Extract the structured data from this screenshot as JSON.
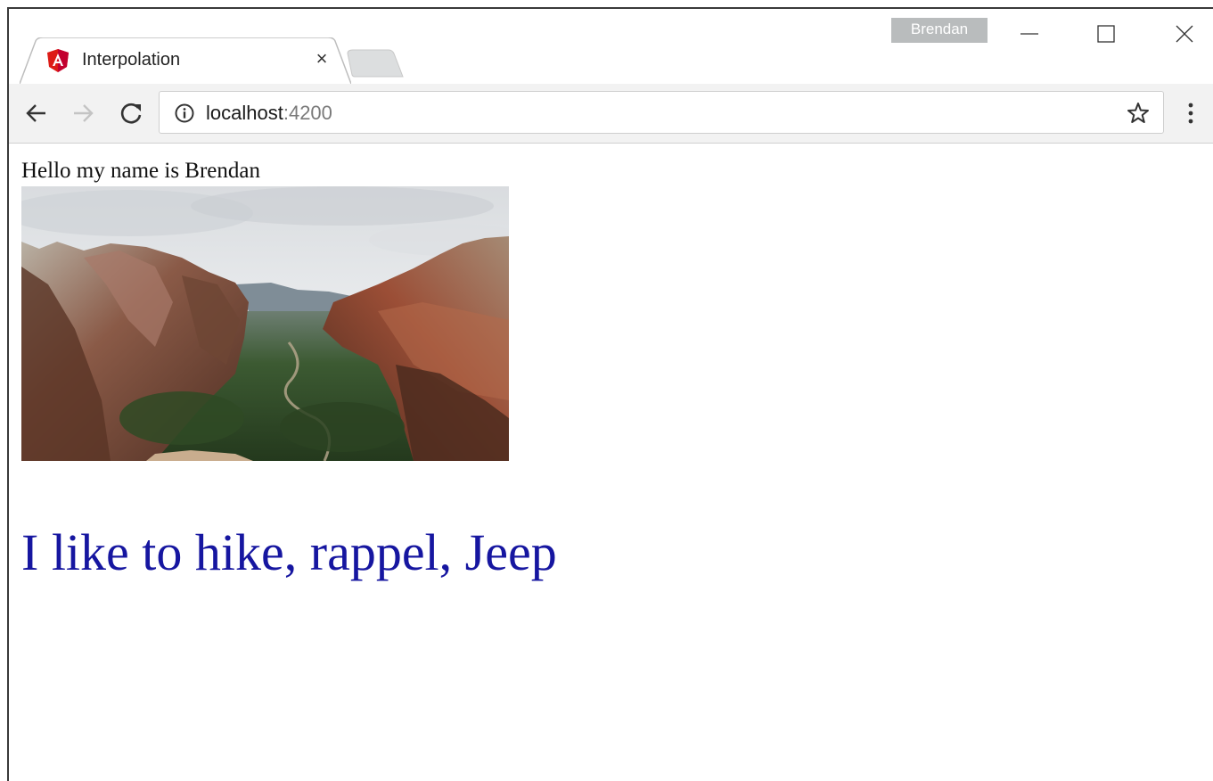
{
  "browser": {
    "tab": {
      "title": "Interpolation",
      "favicon": "angular-icon",
      "close_glyph": "×"
    },
    "profile_name": "Brendan",
    "window_controls": [
      "minimize-icon",
      "maximize-icon",
      "close-icon"
    ],
    "address": {
      "host": "localhost",
      "port": ":4200",
      "leading_icon": "info-icon",
      "trailing_icon": "star-icon"
    },
    "nav_icons": [
      "back-arrow-icon",
      "forward-arrow-icon",
      "reload-icon"
    ],
    "menu_icon": "kebab-menu-icon"
  },
  "page": {
    "greeting": "Hello my name is Brendan",
    "hobbies": "I like to hike, rappel, Jeep",
    "hobbies_color": "#1616a0"
  },
  "colors": {
    "angular_red": "#dd1b16",
    "toolbar_bg": "#f2f2f2",
    "profile_badge_bg": "#b9bcbd"
  }
}
